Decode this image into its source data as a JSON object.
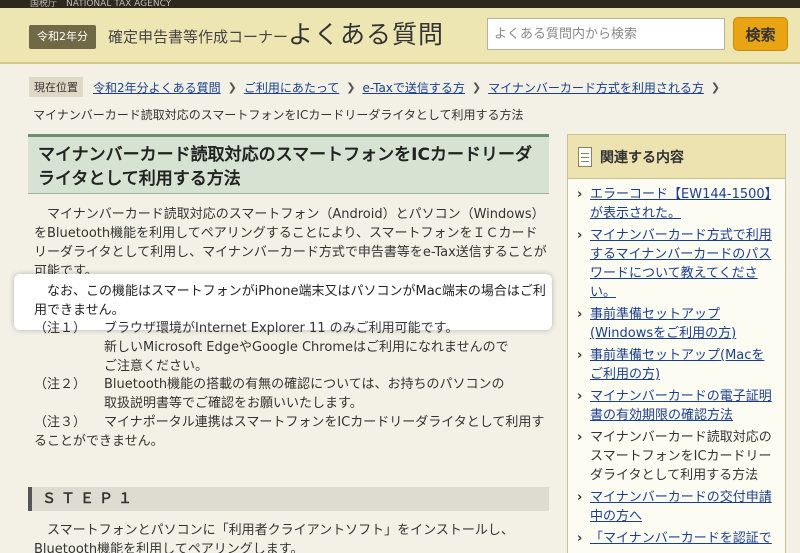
{
  "header": {
    "top_strip": "国税庁　NATIONAL TAX AGENCY",
    "era_badge": "令和2年分",
    "corner_title": "確定申告書等作成コーナー",
    "faq_title": "よくある質問",
    "search_placeholder": "よくある質問内から検索",
    "search_button": "検索"
  },
  "breadcrumb": {
    "current_label": "現在位置",
    "items": [
      "令和2年分よくある質問",
      "ご利用にあたって",
      "e-Taxで送信する方",
      "マイナンバーカード方式を利用される方"
    ],
    "current_page": "マイナンバーカード読取対応のスマートフォンをICカードリーダライタとして利用する方法"
  },
  "main": {
    "title": "マイナンバーカード読取対応のスマートフォンをICカードリーダライタとして利用する方法",
    "paragraph1": "マイナンバーカード読取対応のスマートフォン（Android）とパソコン（Windows）をBluetooth機能を利用してペアリングすることにより、スマートフォンをＩＣカードリーダライタとして利用し、マイナンバーカード方式で申告書等をe-Tax送信することが可能です。",
    "paragraph2": "なお、この機能はスマートフォンがiPhone端末又はパソコンがMac端末の場合はご利用できません。",
    "notes": [
      {
        "label": "（注１）",
        "line1": "ブラウザ環境がInternet Explorer 11 のみご利用可能です。",
        "line2": "新しいMicrosoft EdgeやGoogle Chromeはご利用になれませんので",
        "line3": "ご注意ください。"
      },
      {
        "label": "（注２）",
        "line1": "Bluetooth機能の搭載の有無の確認については、お持ちのパソコンの",
        "line2": "取扱説明書等でご確認をお願いいたします。"
      },
      {
        "label": "（注３）",
        "line1": "マイナポータル連携はスマートフォンをICカードリーダライタとして利用することができません。"
      }
    ],
    "step_heading": "ＳＴＥＰ１",
    "paragraph3": "スマートフォンとパソコンに「利用者クライアントソフト」をインストールし、Bluetooth機能を利用してペアリングします。"
  },
  "sidebar": {
    "title": "関連する内容",
    "items": [
      {
        "text": "エラーコード【EW144-1500】が表示された。",
        "link": true
      },
      {
        "text": "マイナンバーカード方式で利用するマイナンバーカードのパスワードについて教えてください。",
        "link": true
      },
      {
        "text": "事前準備セットアップ(Windowsをご利用の方)",
        "link": true
      },
      {
        "text": "事前準備セットアップ(Macをご利用の方)",
        "link": true
      },
      {
        "text": "マイナンバーカードの電子証明書の有効期限の確認方法",
        "link": true
      },
      {
        "text": "マイナンバーカード読取対応のスマートフォンをICカードリーダライタとして利用する方法",
        "link": false
      },
      {
        "text": "マイナンバーカードの交付申請中の方へ",
        "link": true
      },
      {
        "text": "「マイナンバーカードを認証で",
        "link": true
      }
    ]
  }
}
